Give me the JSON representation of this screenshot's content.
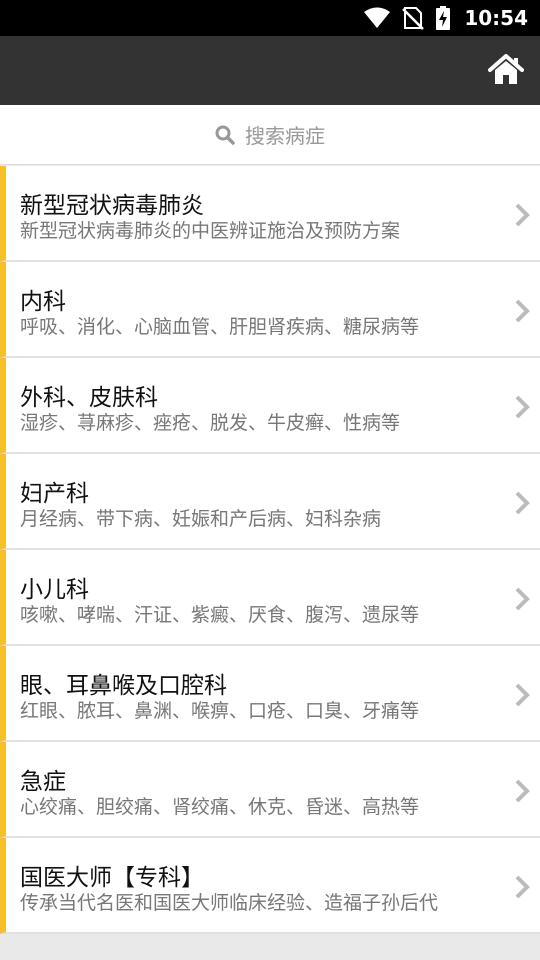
{
  "status_bar": {
    "time": "10:54",
    "icons": [
      "wifi-icon",
      "no-sim-icon",
      "battery-charging-icon"
    ]
  },
  "app_bar": {
    "home_icon": "home-icon"
  },
  "search": {
    "icon": "search-icon",
    "placeholder": "搜索病症"
  },
  "colors": {
    "accent": "#f5c02c",
    "app_bar": "#333333",
    "status_bar": "#000000"
  },
  "categories": [
    {
      "title": "新型冠状病毒肺炎",
      "desc": "新型冠状病毒肺炎的中医辨证施治及预防方案"
    },
    {
      "title": "内科",
      "desc": "呼吸、消化、心脑血管、肝胆肾疾病、糖尿病等"
    },
    {
      "title": "外科、皮肤科",
      "desc": "湿疹、荨麻疹、痤疮、脱发、牛皮癣、性病等"
    },
    {
      "title": "妇产科",
      "desc": "月经病、带下病、妊娠和产后病、妇科杂病"
    },
    {
      "title": "小儿科",
      "desc": "咳嗽、哮喘、汗证、紫癜、厌食、腹泻、遗尿等"
    },
    {
      "title": "眼、耳鼻喉及口腔科",
      "desc": "红眼、脓耳、鼻渊、喉痹、口疮、口臭、牙痛等"
    },
    {
      "title": "急症",
      "desc": "心绞痛、胆绞痛、肾绞痛、休克、昏迷、高热等"
    },
    {
      "title": "国医大师【专科】",
      "desc": "传承当代名医和国医大师临床经验、造福子孙后代"
    }
  ]
}
